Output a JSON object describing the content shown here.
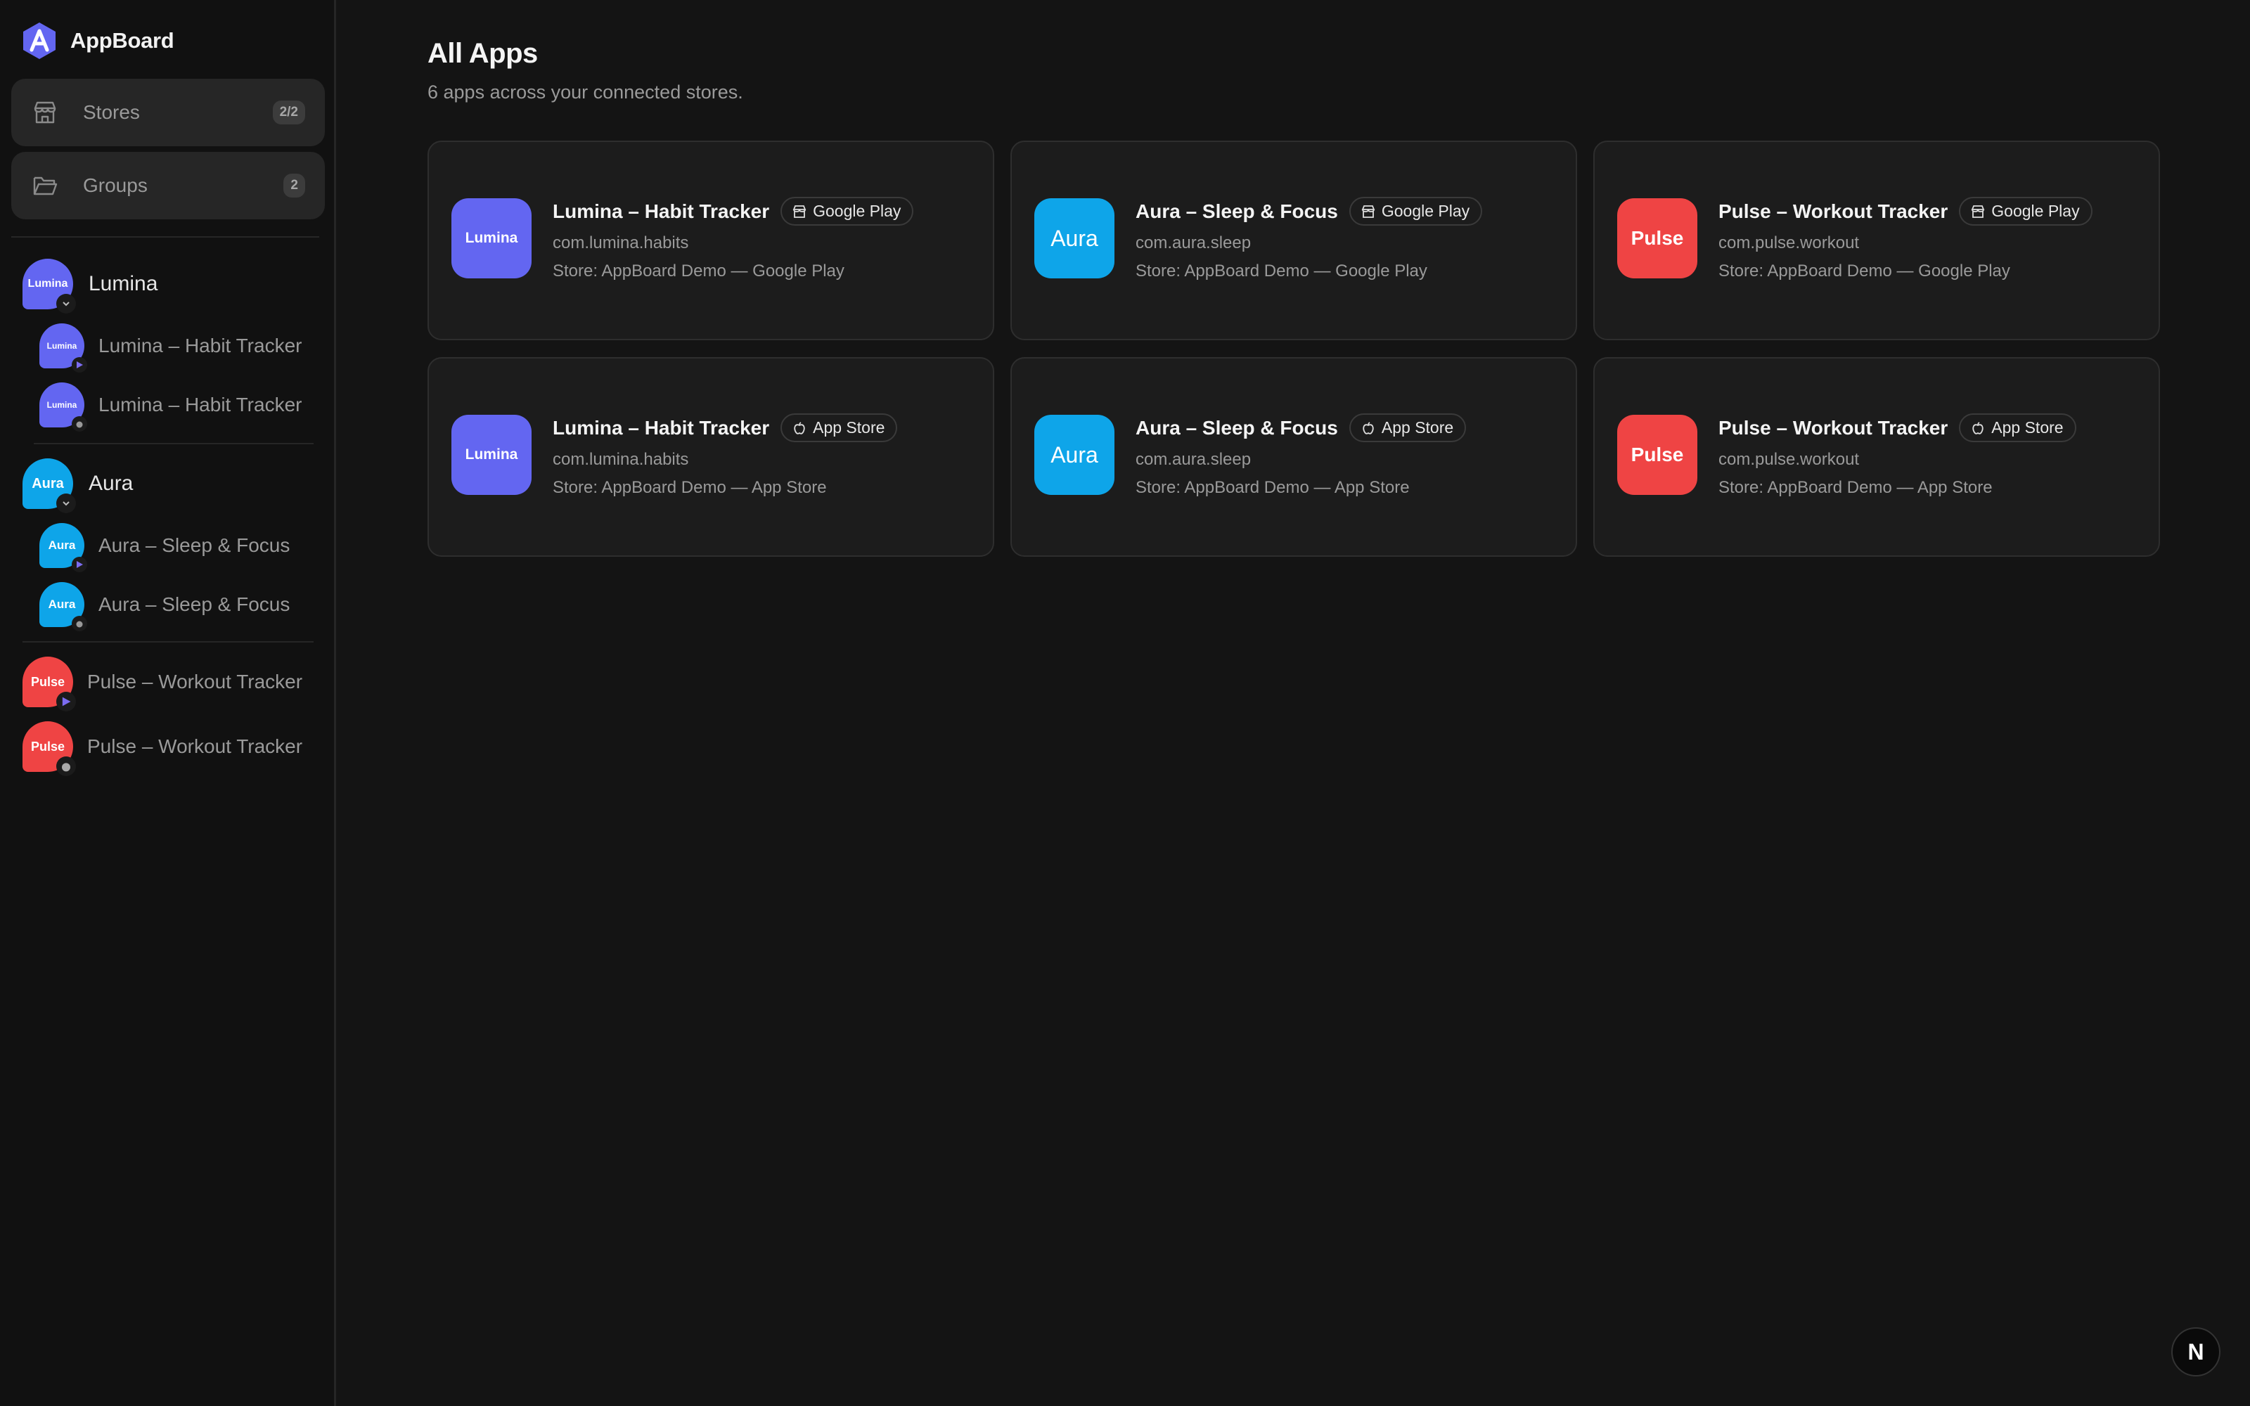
{
  "app": {
    "name": "AppBoard"
  },
  "nav": {
    "stores": {
      "label": "Stores",
      "badge": "2/2"
    },
    "groups": {
      "label": "Groups",
      "badge": "2"
    }
  },
  "sidebar_groups": [
    {
      "name": "Lumina",
      "icon_text": "Lumina",
      "color": "#6366f1",
      "children": [
        {
          "name": "Lumina – Habit Tracker",
          "store": "google-play"
        },
        {
          "name": "Lumina – Habit Tracker",
          "store": "app-store"
        }
      ]
    },
    {
      "name": "Aura",
      "icon_text": "Aura",
      "color": "#0ea5e9",
      "children": [
        {
          "name": "Aura – Sleep & Focus",
          "store": "google-play"
        },
        {
          "name": "Aura – Sleep & Focus",
          "store": "app-store"
        }
      ]
    }
  ],
  "sidebar_ungrouped": [
    {
      "name": "Pulse – Workout Tracker",
      "icon_text": "Pulse",
      "color": "#ef4444",
      "store": "google-play"
    },
    {
      "name": "Pulse – Workout Tracker",
      "icon_text": "Pulse",
      "color": "#ef4444",
      "store": "app-store"
    }
  ],
  "main": {
    "title": "All Apps",
    "subtitle": "6 apps across your connected stores.",
    "cards": [
      {
        "name": "Lumina – Habit Tracker",
        "icon_text": "Lumina",
        "store_label": "Google Play",
        "bundle": "com.lumina.habits",
        "store_line": "Store: AppBoard Demo — Google Play"
      },
      {
        "name": "Aura – Sleep & Focus",
        "icon_text": "Aura",
        "store_label": "Google Play",
        "bundle": "com.aura.sleep",
        "store_line": "Store: AppBoard Demo — Google Play"
      },
      {
        "name": "Pulse – Workout Tracker",
        "icon_text": "Pulse",
        "store_label": "Google Play",
        "bundle": "com.pulse.workout",
        "store_line": "Store: AppBoard Demo — Google Play"
      },
      {
        "name": "Lumina – Habit Tracker",
        "icon_text": "Lumina",
        "store_label": "App Store",
        "bundle": "com.lumina.habits",
        "store_line": "Store: AppBoard Demo — App Store"
      },
      {
        "name": "Aura – Sleep & Focus",
        "icon_text": "Aura",
        "store_label": "App Store",
        "bundle": "com.aura.sleep",
        "store_line": "Store: AppBoard Demo — App Store"
      },
      {
        "name": "Pulse – Workout Tracker",
        "icon_text": "Pulse",
        "store_label": "App Store",
        "bundle": "com.pulse.workout",
        "store_line": "Store: AppBoard Demo — App Store"
      }
    ]
  },
  "colors": {
    "lumina": "#6366f1",
    "aura": "#0ea5e9",
    "pulse": "#ef4444",
    "background": "#141414",
    "card": "#1c1c1c"
  },
  "icons": [
    "appboard-logo-icon",
    "store-icon",
    "folder-icon",
    "chevron-down-icon",
    "google-play-icon",
    "apple-icon"
  ],
  "overlay_badge": "N"
}
